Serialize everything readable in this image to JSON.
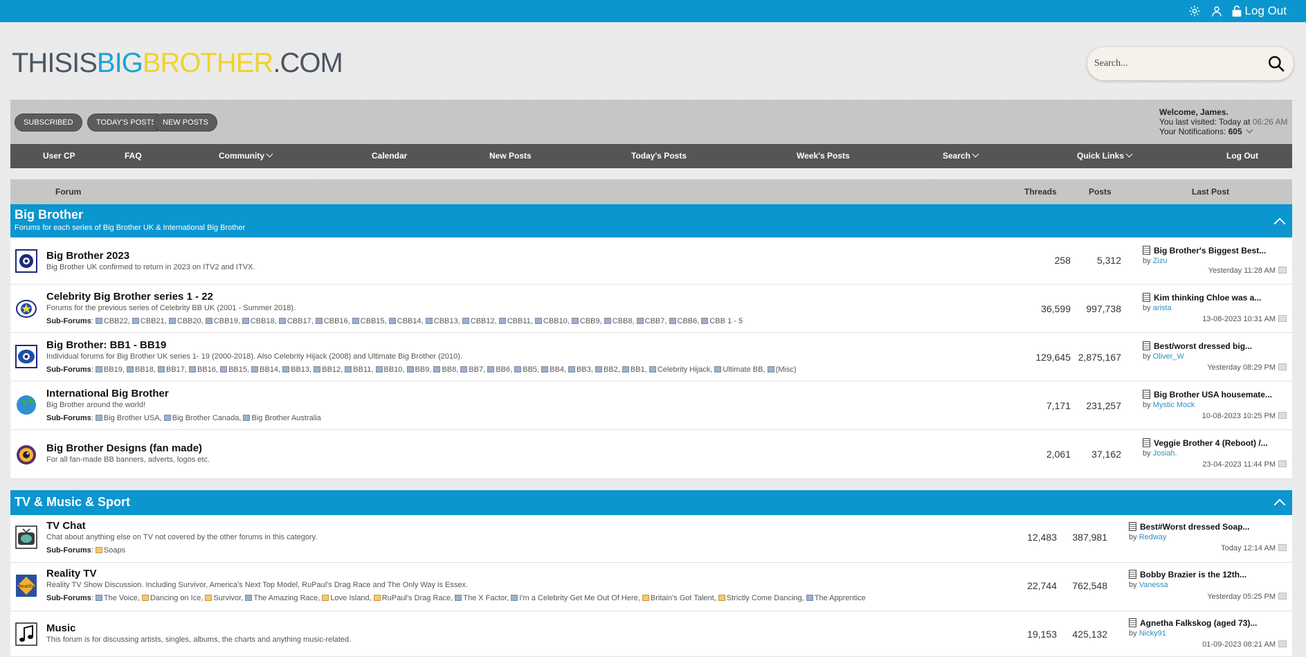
{
  "topbar": {
    "logout_label": "Log Out"
  },
  "logo": {
    "part1": "THISIS",
    "part2": "BIG",
    "part3": "BROTHER",
    "part4": ".COM"
  },
  "search": {
    "placeholder": "Search..."
  },
  "quick_buttons": [
    "SUBSCRIBED",
    "TODAY'S POSTS",
    "NEW POSTS"
  ],
  "welcome": {
    "greeting": "Welcome, James.",
    "last_visited_label": "You last visited: Today at",
    "last_visited_time": "06:26 AM",
    "notifications_label": "Your Notifications:",
    "notifications_count": "605"
  },
  "nav": [
    "User CP",
    "FAQ",
    "Community",
    "Calendar",
    "New Posts",
    "Today's Posts",
    "Week's Posts",
    "Search",
    "Quick Links",
    "Log Out"
  ],
  "columns": {
    "forum": "Forum",
    "threads": "Threads",
    "posts": "Posts",
    "last_post": "Last Post"
  },
  "categories": [
    {
      "title": "Big Brother",
      "desc": "Forums for each series of Big Brother UK & International Big Brother",
      "forums": [
        {
          "name": "Big Brother 2023",
          "desc": "Big Brother UK confirmed to return in 2023 on ITV2 and ITVX.",
          "threads": "258",
          "posts": "5,312",
          "last_title": "Big Brother's Biggest Best...",
          "last_by": "Zizu",
          "last_date": "Yesterday 11:28 AM"
        },
        {
          "name": "Celebrity Big Brother series 1 - 22",
          "desc": "Forums for the previous series of Celebrity BB UK (2001 - Summer 2018).",
          "subforums_label": "Sub-Forums",
          "subforums": [
            "CBB22",
            "CBB21",
            "CBB20",
            "CBB19",
            "CBB18",
            "CBB17",
            "CBB16",
            "CBB15",
            "CBB14",
            "CBB13",
            "CBB12",
            "CBB11",
            "CBB10",
            "CBB9",
            "CBB8",
            "CBB7",
            "CBB6",
            "CBB 1 - 5"
          ],
          "threads": "36,599",
          "posts": "997,738",
          "last_title": "Kim thinking Chloe was a...",
          "last_by": "arista",
          "last_date": "13-08-2023 10:31 AM"
        },
        {
          "name": "Big Brother: BB1 - BB19",
          "desc": "Individual forums for Big Brother UK series 1- 19 (2000-2018). Also Celebrity Hijack (2008) and Ultimate Big Brother (2010).",
          "subforums_label": "Sub-Forums",
          "subforums": [
            "BB19",
            "BB18",
            "BB17",
            "BB16",
            "BB15",
            "BB14",
            "BB13",
            "BB12",
            "BB11",
            "BB10",
            "BB9",
            "BB8",
            "BB7",
            "BB6",
            "BB5",
            "BB4",
            "BB3",
            "BB2",
            "BB1",
            "Celebrity Hijack",
            "Ultimate BB",
            "(Misc)"
          ],
          "threads": "129,645",
          "posts": "2,875,167",
          "last_title": "Best/worst dressed big...",
          "last_by": "Oliver_W",
          "last_date": "Yesterday 08:29 PM"
        },
        {
          "name": "International Big Brother",
          "desc": "Big Brother around the world!",
          "subforums_label": "Sub-Forums",
          "subforums": [
            "Big Brother USA",
            "Big Brother Canada",
            "Big Brother Australia"
          ],
          "threads": "7,171",
          "posts": "231,257",
          "last_title": "Big Brother USA housemate...",
          "last_by": "Mystic Mock",
          "last_date": "10-08-2023 10:25 PM"
        },
        {
          "name": "Big Brother Designs (fan made)",
          "desc": "For all fan-made BB banners, adverts, logos etc.",
          "threads": "2,061",
          "posts": "37,162",
          "last_title": "Veggie Brother 4 (Reboot) /...",
          "last_by": "Josiah.",
          "last_date": "23-04-2023 11:44 PM"
        }
      ]
    },
    {
      "title": "TV & Music & Sport",
      "forums": [
        {
          "name": "TV Chat",
          "desc": "Chat about anything else on TV not covered by the other forums in this category.",
          "subforums_label": "Sub-Forums",
          "subforums": [
            "Soaps"
          ],
          "threads": "12,483",
          "posts": "387,981",
          "last_title": "Best#Worst dressed Soap...",
          "last_by": "Redway",
          "last_date": "Today 12:14 AM"
        },
        {
          "name": "Reality TV",
          "desc": "Reality TV Show Discussion. Including Survivor, America's Next Top Model, RuPaul's Drag Race and The Only Way is Essex.",
          "subforums_label": "Sub-Forums",
          "subforums": [
            "The Voice",
            "Dancing on Ice",
            "Survivor",
            "The Amazing Race",
            "Love Island",
            "RuPaul's Drag Race",
            "The X Factor",
            "I'm a Celebrity Get Me Out Of Here",
            "Britain's Got Talent",
            "Strictly Come Dancing",
            "The Apprentice"
          ],
          "threads": "22,744",
          "posts": "762,548",
          "last_title": "Bobby Brazier is the 12th...",
          "last_by": "Vanessa",
          "last_date": "Yesterday 05:25 PM"
        },
        {
          "name": "Music",
          "desc": "This forum is for discussing artists, singles, albums, the charts and anything music-related.",
          "threads": "19,153",
          "posts": "425,132",
          "last_title": "Agnetha Falkskog (aged 73)...",
          "last_by": "Nicky91",
          "last_date": "01-09-2023 08:21 AM"
        }
      ]
    }
  ],
  "by_label": "by"
}
